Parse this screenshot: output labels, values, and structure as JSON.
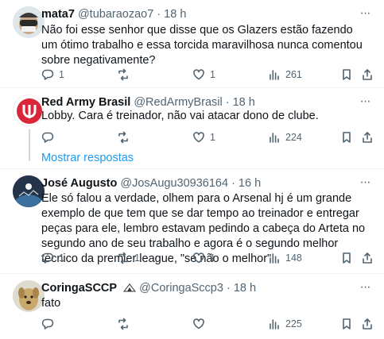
{
  "tweets": [
    {
      "name": "mata7",
      "handle": "@tubaraozao7",
      "time": "· 18 h",
      "text": "Não foi esse senhor que disse que os Glazers estão fazendo um ótimo trabalho e essa torcida maravilhosa nunca comentou sobre negativamente?",
      "replies": "1",
      "retweets": "",
      "likes": "1",
      "views": "261"
    },
    {
      "name": "Red Army Brasil",
      "handle": "@RedArmyBrasil",
      "time": "· 18 h",
      "text": "Lobby. Cara é treinador, não vai atacar dono de clube.",
      "replies": "",
      "retweets": "",
      "likes": "1",
      "views": "224",
      "brand_color": "#d9263b"
    },
    {
      "name": "José Augusto",
      "handle": "@JosAugu30936164",
      "time": "· 16 h",
      "text": "Ele só falou a verdade, olhem para o Arsenal hj é um grande exemplo de que tem que se dar tempo ao treinador e entregar peças para ele, lembro estavam pedindo a cabeça do Arteta no segundo ano de seu trabalho e agora é o segundo melhor técnico da premier league, \"se não o melhor\"",
      "replies": "1",
      "retweets": "1",
      "likes": "1",
      "views": "148"
    },
    {
      "name": "CoringaSCCP",
      "handle": "@CoringaSccp3",
      "time": "· 18 h",
      "text": "fato",
      "replies": "",
      "retweets": "",
      "likes": "",
      "views": "225"
    }
  ],
  "show_more_replies": "Mostrar respostas",
  "icons": {
    "more": "more-dots-icon",
    "reply": "reply-icon",
    "retweet": "retweet-icon",
    "like": "heart-icon",
    "views": "views-icon",
    "bookmark": "bookmark-icon",
    "share": "share-icon"
  },
  "colors": {
    "link": "#1d9bf0",
    "muted": "#536471",
    "text": "#0f1419"
  }
}
